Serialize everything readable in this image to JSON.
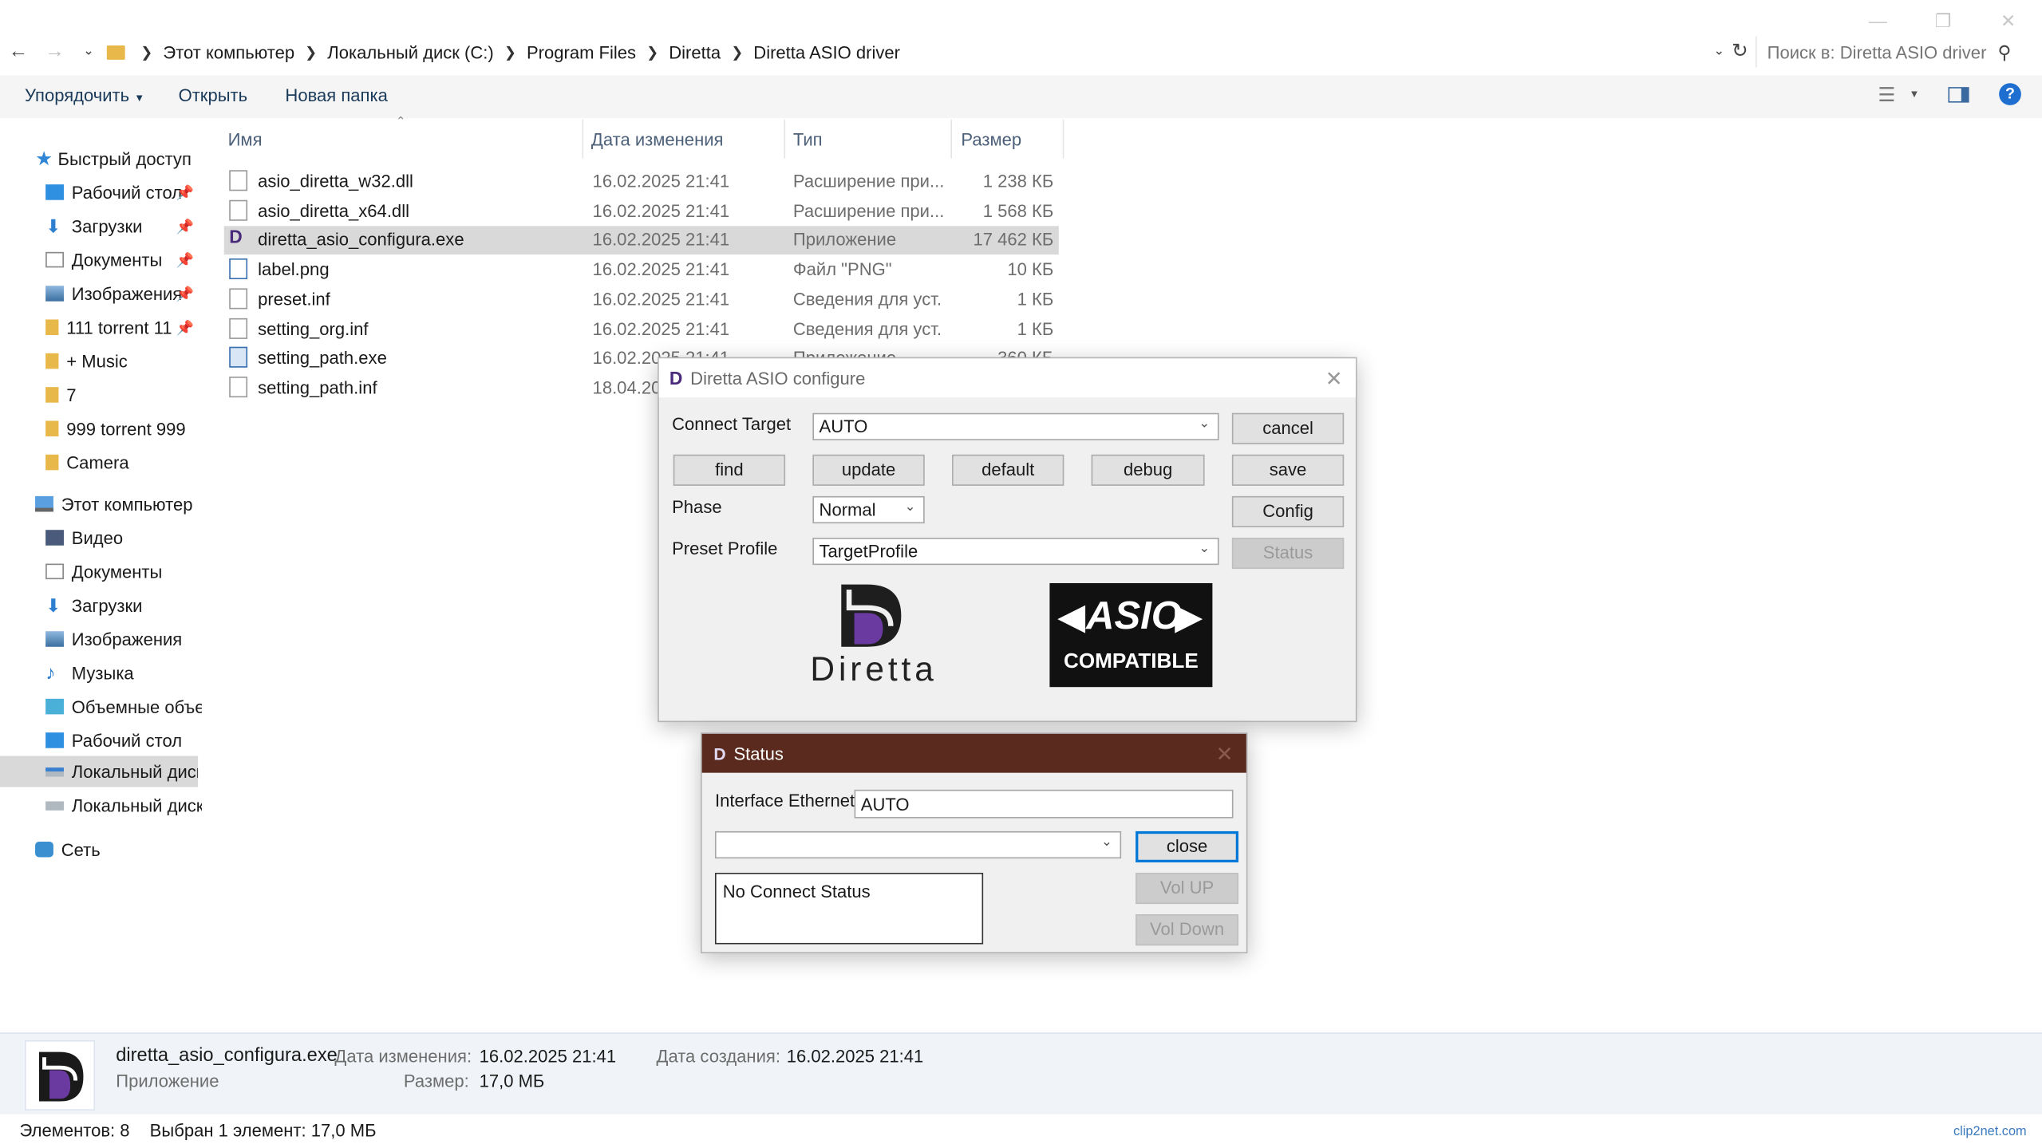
{
  "window_controls": {
    "minimize": "—",
    "restore": "❐",
    "close": "✕"
  },
  "breadcrumb": [
    "Этот компьютер",
    "Локальный диск (C:)",
    "Program Files",
    "Diretta",
    "Diretta ASIO driver"
  ],
  "search": {
    "placeholder": "Поиск в: Diretta ASIO driver"
  },
  "ribbon": {
    "organize": "Упорядочить",
    "open": "Открыть",
    "new_folder": "Новая папка"
  },
  "sidebar": {
    "quick_access": "Быстрый доступ",
    "pinned": [
      "Рабочий стол",
      "Загрузки",
      "Документы",
      "Изображения",
      "111 torrent 11"
    ],
    "folders": [
      "+ Music",
      "7",
      "999 torrent 999",
      "Camera"
    ],
    "this_pc": "Этот компьютер",
    "pc_items": [
      "Видео",
      "Документы",
      "Загрузки",
      "Изображения",
      "Музыка",
      "Объемные объекты",
      "Рабочий стол",
      "Локальный диск (C:)",
      "Локальный диск (D:)"
    ],
    "network": "Сеть"
  },
  "columns": {
    "name": "Имя",
    "date": "Дата изменения",
    "type": "Тип",
    "size": "Размер"
  },
  "files": [
    {
      "name": "asio_diretta_w32.dll",
      "date": "16.02.2025 21:41",
      "type": "Расширение при...",
      "size": "1 238 КБ"
    },
    {
      "name": "asio_diretta_x64.dll",
      "date": "16.02.2025 21:41",
      "type": "Расширение при...",
      "size": "1 568 КБ"
    },
    {
      "name": "diretta_asio_configura.exe",
      "date": "16.02.2025 21:41",
      "type": "Приложение",
      "size": "17 462 КБ"
    },
    {
      "name": "label.png",
      "date": "16.02.2025 21:41",
      "type": "Файл \"PNG\"",
      "size": "10 КБ"
    },
    {
      "name": "preset.inf",
      "date": "16.02.2025 21:41",
      "type": "Сведения для уст...",
      "size": "1 КБ"
    },
    {
      "name": "setting_org.inf",
      "date": "16.02.2025 21:41",
      "type": "Сведения для уст...",
      "size": "1 КБ"
    },
    {
      "name": "setting_path.exe",
      "date": "16.02.2025 21:41",
      "type": "Приложение",
      "size": "360 КБ"
    },
    {
      "name": "setting_path.inf",
      "date": "18.04.2025",
      "type": "",
      "size": ""
    }
  ],
  "details": {
    "filename": "diretta_asio_configura.exe",
    "kind": "Приложение",
    "modified_label": "Дата изменения:",
    "modified": "16.02.2025 21:41",
    "size_label": "Размер:",
    "size": "17,0 МБ",
    "created_label": "Дата создания:",
    "created": "16.02.2025 21:41"
  },
  "statusbar": {
    "count": "Элементов: 8",
    "selected": "Выбран 1 элемент: 17,0 МБ"
  },
  "config_dialog": {
    "title": "Diretta ASIO configure",
    "connect_target_label": "Connect Target",
    "connect_target_value": "AUTO",
    "phase_label": "Phase",
    "phase_value": "Normal",
    "preset_label": "Preset Profile",
    "preset_value": "TargetProfile",
    "buttons": {
      "cancel": "cancel",
      "find": "find",
      "update": "update",
      "default": "default",
      "debug": "debug",
      "save": "save",
      "config": "Config",
      "status": "Status"
    },
    "logo_text": "Diretta",
    "asio_text": "ASIO",
    "asio_sub": "COMPATIBLE"
  },
  "status_dialog": {
    "title": "Status",
    "iface_label": "Interface Ethernet",
    "iface_value": "AUTO",
    "status_text": "No Connect Status",
    "buttons": {
      "close": "close",
      "vol_up": "Vol UP",
      "vol_down": "Vol Down"
    }
  },
  "watermark": "clip2net.com"
}
